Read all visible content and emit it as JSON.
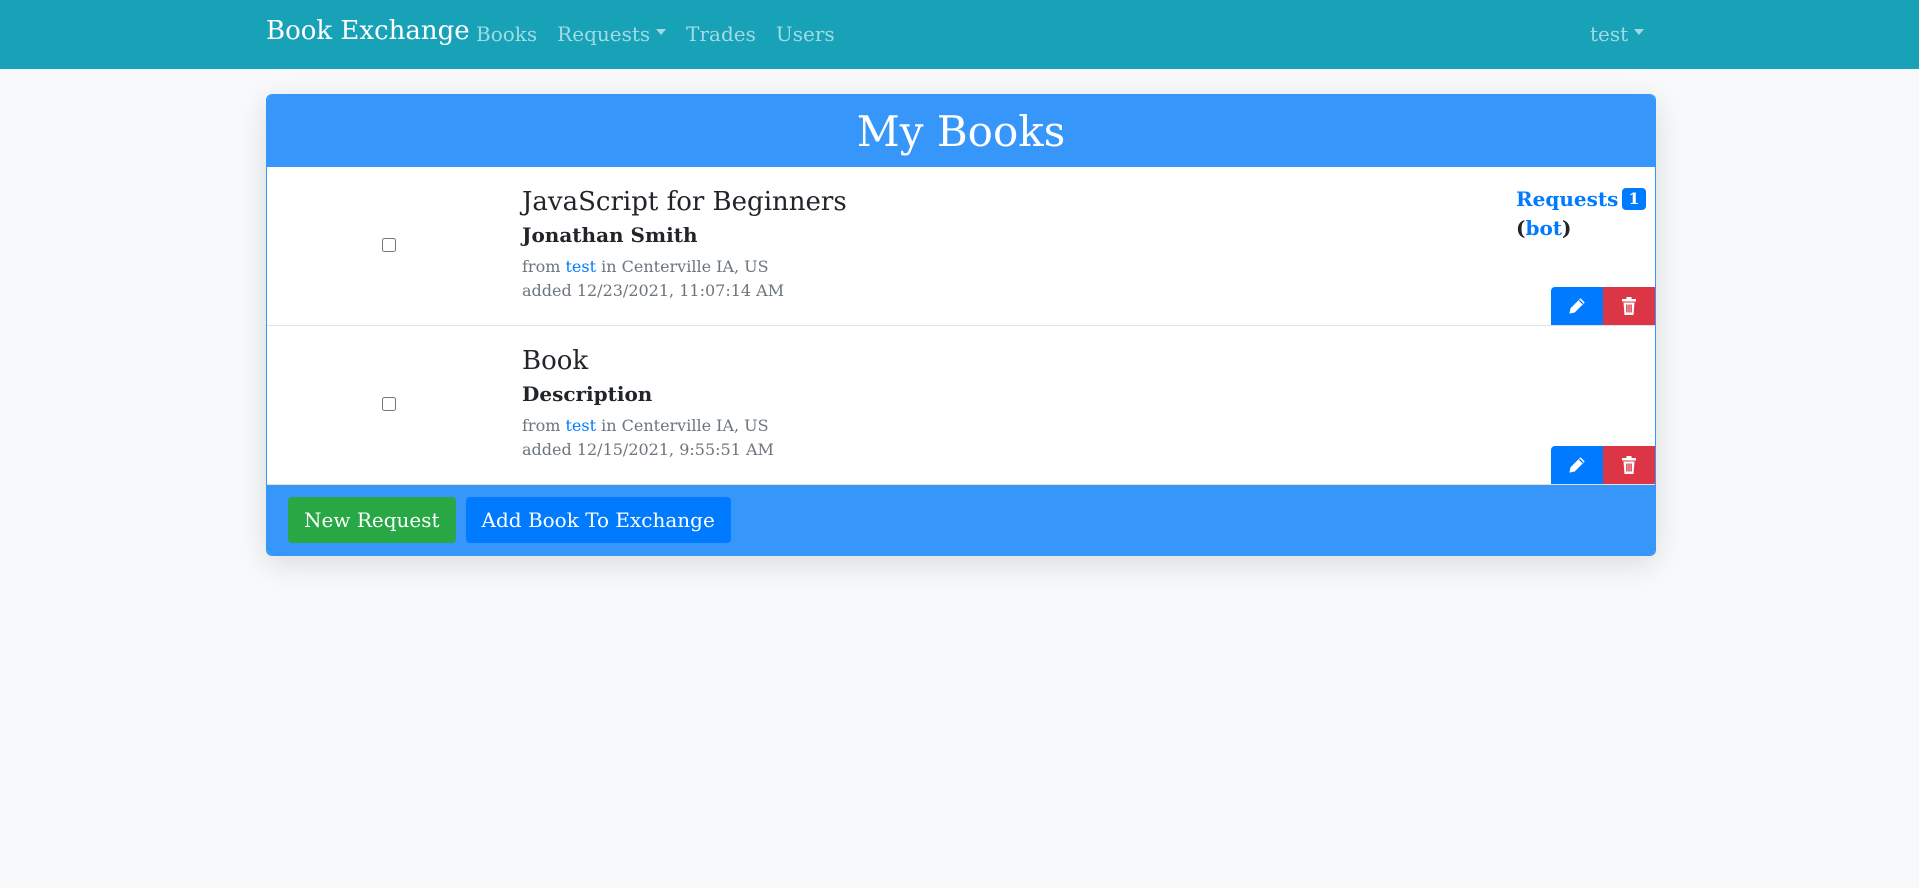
{
  "navbar": {
    "brand": "Book Exchange",
    "links": [
      {
        "label": "Books"
      },
      {
        "label": "Requests"
      },
      {
        "label": "Trades"
      },
      {
        "label": "Users"
      }
    ],
    "user": "test"
  },
  "card": {
    "title": "My Books",
    "books": [
      {
        "title": "JavaScript for Beginners",
        "description": "Jonathan Smith",
        "from_label": "from",
        "owner": "test",
        "location": "in Centerville IA, US",
        "added": "added 12/23/2021, 11:07:14 AM",
        "requests_label": "Requests",
        "requests_count": "1",
        "requester": "bot",
        "open_paren": "(",
        "close_paren": ")"
      },
      {
        "title": "Book",
        "description": "Description",
        "from_label": "from",
        "owner": "test",
        "location": "in Centerville IA, US",
        "added": "added 12/15/2021, 9:55:51 AM"
      }
    ],
    "footer": {
      "new_request": "New Request",
      "add_book": "Add Book To Exchange"
    }
  },
  "icons": {
    "edit": "pencil-icon",
    "delete": "trash-icon"
  },
  "colors": {
    "navbar": "#17a2b8",
    "card_accent": "#3796fa",
    "primary": "#007bff",
    "success": "#28a745",
    "danger": "#dc3545"
  }
}
